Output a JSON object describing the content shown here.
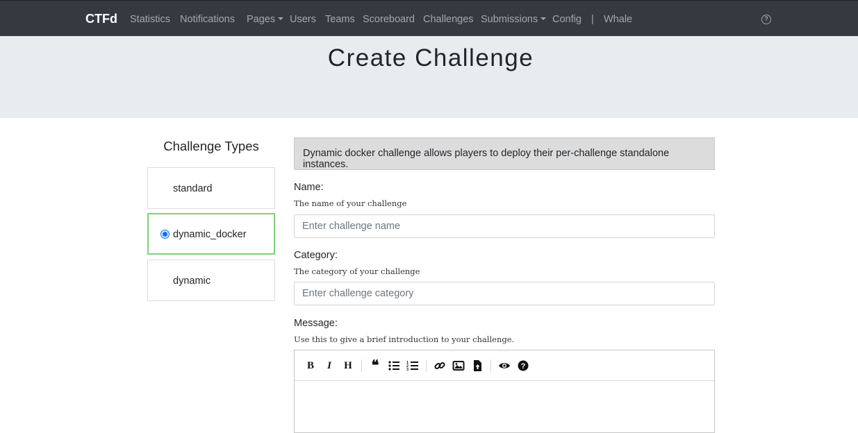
{
  "navbar": {
    "brand": "CTFd",
    "items": [
      {
        "label": "Statistics"
      },
      {
        "label": "Notifications"
      },
      {
        "label": "Pages",
        "dropdown": true
      },
      {
        "label": "Users"
      },
      {
        "label": "Teams"
      },
      {
        "label": "Scoreboard"
      },
      {
        "label": "Challenges"
      },
      {
        "label": "Submissions",
        "dropdown": true
      },
      {
        "label": "Config"
      },
      {
        "label": "|"
      },
      {
        "label": "Whale"
      }
    ],
    "help_icon": "question-circle-icon"
  },
  "page": {
    "title": "Create Challenge"
  },
  "challenge_types": {
    "title": "Challenge Types",
    "items": [
      {
        "label": "standard",
        "selected": false
      },
      {
        "label": "dynamic_docker",
        "selected": true
      },
      {
        "label": "dynamic",
        "selected": false
      }
    ]
  },
  "form": {
    "description": "Dynamic docker challenge allows players to deploy their per-challenge standalone instances.",
    "name": {
      "label": "Name:",
      "help": "The name of your challenge",
      "placeholder": "Enter challenge name",
      "value": ""
    },
    "category": {
      "label": "Category:",
      "help": "The category of your challenge",
      "placeholder": "Enter challenge category",
      "value": ""
    },
    "message": {
      "label": "Message:",
      "help": "Use this to give a brief introduction to your challenge."
    }
  },
  "editor_toolbar": [
    {
      "icon": "bold-icon"
    },
    {
      "icon": "italic-icon"
    },
    {
      "icon": "heading-icon"
    },
    {
      "icon": "quote-icon"
    },
    {
      "icon": "unordered-list-icon"
    },
    {
      "icon": "ordered-list-icon"
    },
    {
      "icon": "link-icon"
    },
    {
      "icon": "image-icon"
    },
    {
      "icon": "upload-file-icon"
    },
    {
      "icon": "preview-icon"
    },
    {
      "icon": "guide-icon"
    }
  ],
  "colors": {
    "navbar_bg": "#343a40",
    "jumbotron_bg": "#e9ecef",
    "selected_border": "#7dd07d",
    "radio": "#0d6efd"
  }
}
